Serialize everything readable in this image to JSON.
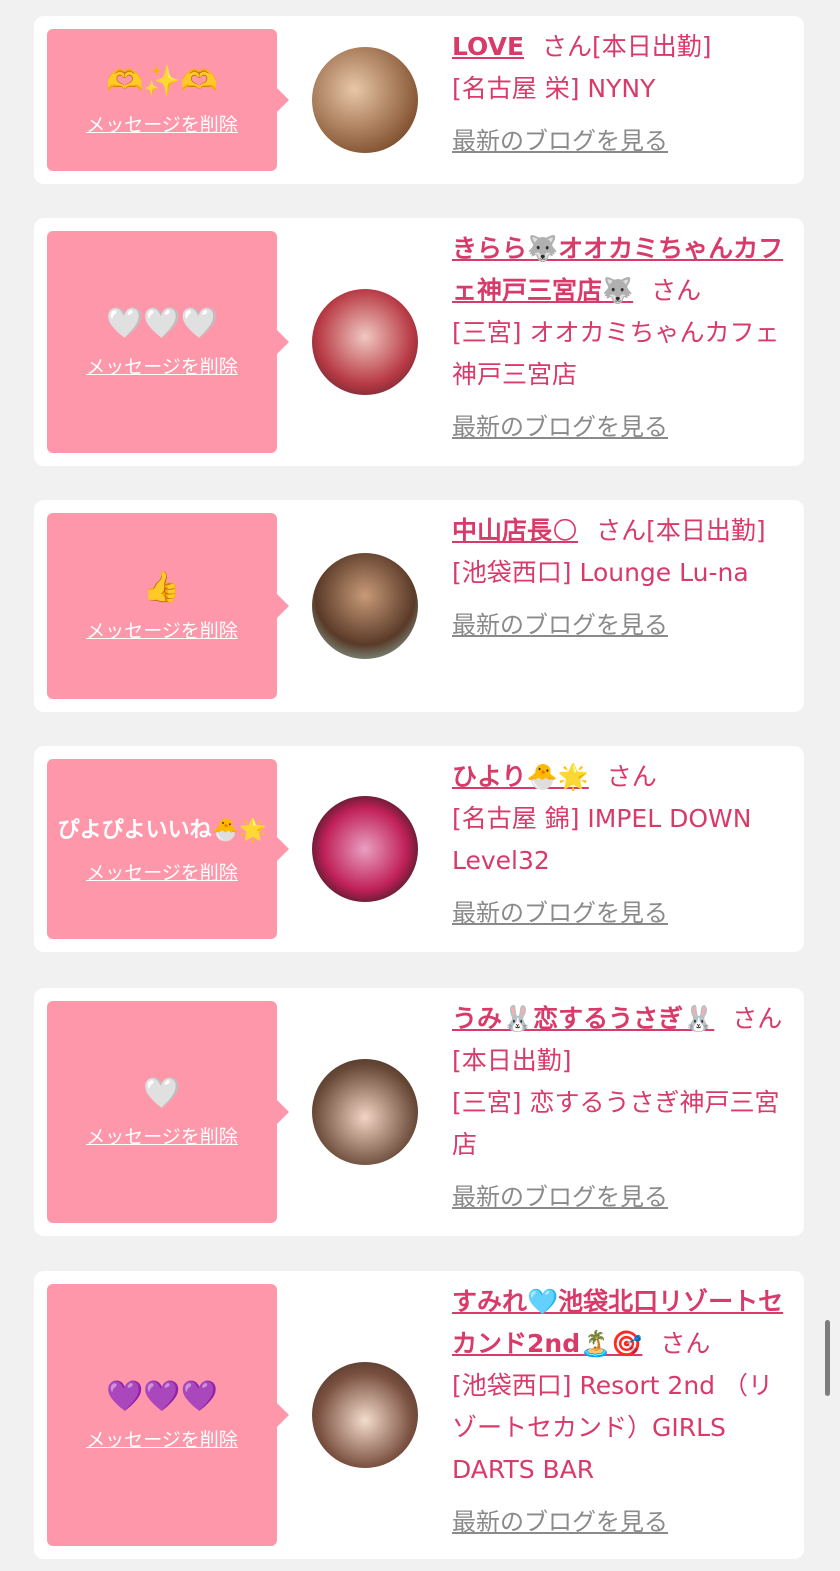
{
  "cards": [
    {
      "msg": "🫶✨🫶",
      "delete": "メッセージを削除",
      "name": "LOVE",
      "suffix": "さん[本日出勤]",
      "shop": "[名古屋 栄] NYNY",
      "blog": "最新のブログを見る"
    },
    {
      "msg": "🤍🤍🤍",
      "delete": "メッセージを削除",
      "name": "きらら🐺オオカミちゃんカフェ神戸三宮店🐺",
      "suffix": "さん",
      "shop": "[三宮] オオカミちゃんカフェ神戸三宮店",
      "blog": "最新のブログを見る"
    },
    {
      "msg": "👍",
      "delete": "メッセージを削除",
      "name": "中山店長🌕",
      "suffix": "さん[本日出勤]",
      "shop": "[池袋西口] Lounge Lu-na",
      "blog": "最新のブログを見る"
    },
    {
      "msg": "ぴよぴよいいね🐣🌟",
      "delete": "メッセージを削除",
      "name": "ひより🐣🌟",
      "suffix": "さん",
      "shop": "[名古屋 錦] IMPEL DOWN Level32",
      "blog": "最新のブログを見る"
    },
    {
      "msg": "🤍",
      "delete": "メッセージを削除",
      "name": "うみ🐰恋するうさぎ🐰",
      "suffix": "さん[本日出勤]",
      "shop": "[三宮] 恋するうさぎ神戸三宮店",
      "blog": "最新のブログを見る"
    },
    {
      "msg": "💜💜💜",
      "delete": "メッセージを削除",
      "name": "すみれ🩵池袋北口リゾートセカンド2nd🏝️🎯",
      "suffix": "さん",
      "shop": "[池袋西口] Resort 2nd （リゾートセカンド）GIRLS DARTS BAR",
      "blog": "最新のブログを見る"
    }
  ],
  "colors": {
    "accent": "#d83a6a",
    "message_bg": "#ff97aa",
    "link_gray": "#8a8a8a"
  }
}
